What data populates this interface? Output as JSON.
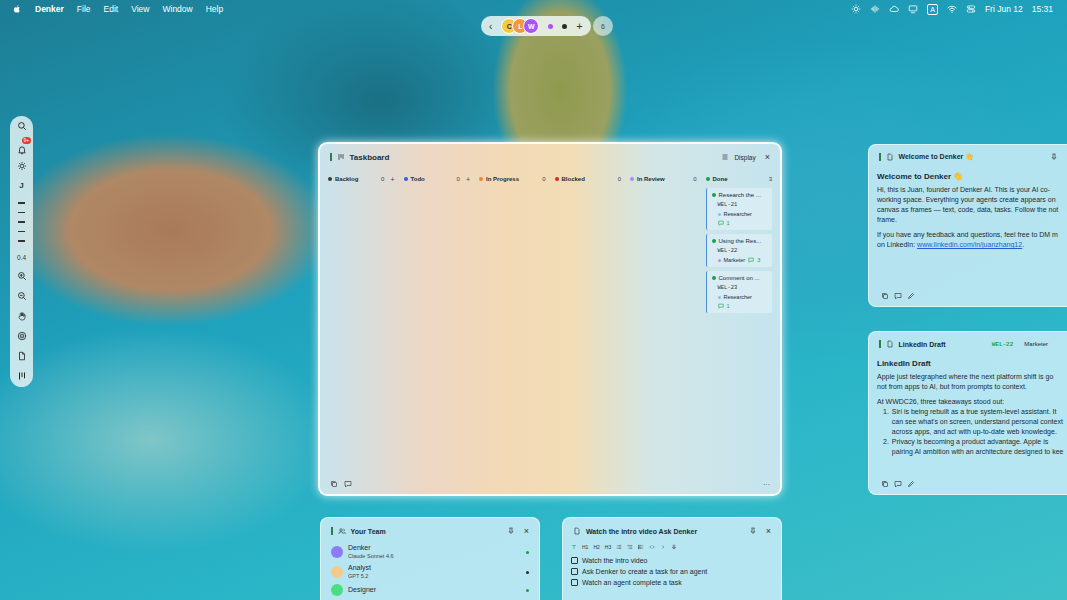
{
  "menu_bar": {
    "app": "Denker",
    "menus": [
      "File",
      "Edit",
      "View",
      "Window",
      "Help"
    ],
    "input_source": "A",
    "date": "Fri Jun 12",
    "time": "15:31"
  },
  "presence": {
    "back": "‹",
    "avatars": [
      {
        "initial": "C",
        "color": "#f6c945"
      },
      {
        "initial": "L",
        "color": "#f29b38"
      },
      {
        "initial": "W",
        "color": "#a855f7"
      }
    ],
    "dots": [
      {
        "color": "#a855f7"
      },
      {
        "color": "#2b2b2b"
      }
    ],
    "add": "+",
    "count": "6"
  },
  "toolbar": {
    "notification_badge": "9+",
    "user_initial": "J",
    "frame_marks": 5,
    "zoom": "0.4"
  },
  "taskboard": {
    "title": "Taskboard",
    "display": "Display",
    "close": "×",
    "more": "···",
    "columns": [
      {
        "name": "Backlog",
        "count": "0",
        "addable": true,
        "add": "+",
        "color": "#3a3a3a",
        "cards": []
      },
      {
        "name": "Todo",
        "count": "0",
        "addable": true,
        "add": "+",
        "color": "#2563eb",
        "cards": []
      },
      {
        "name": "In Progress",
        "count": "0",
        "addable": false,
        "add": "",
        "color": "#e8873a",
        "cards": []
      },
      {
        "name": "Blocked",
        "count": "0",
        "addable": false,
        "add": "",
        "color": "#dc2626",
        "cards": []
      },
      {
        "name": "In Review",
        "count": "0",
        "addable": false,
        "add": "",
        "color": "#a78bfa",
        "cards": []
      },
      {
        "name": "Done",
        "count": "3",
        "addable": false,
        "add": "",
        "color": "#16a34a",
        "cards": [
          {
            "title": "Research the ...",
            "id": "WEL-21",
            "role": "Researcher",
            "role_color": "#7cc4e8",
            "comments": "1"
          },
          {
            "title": "Using the Res...",
            "id": "WEL-22",
            "role": "Marketer",
            "role_color": "#b98be8",
            "comments": "3"
          },
          {
            "title": "Comment on ...",
            "id": "WEL-23",
            "role": "Researcher",
            "role_color": "#7cc4e8",
            "comments": "1"
          }
        ]
      }
    ]
  },
  "welcome": {
    "header": "Welcome to Denker 👋",
    "heading": "Welcome to Denker 👋",
    "lines": [
      "Hi, this is Juan, founder of Denker AI. This is your AI co-",
      "working space. Everything your agents create appears on",
      "canvas as frames — text, code, data, tasks. Follow the not",
      "frame."
    ],
    "feedback_line": "If you have any feedback and questions, feel free to DM m",
    "link_prefix": "on LinkedIn: ",
    "link": "www.linkedin.com/in/juanzhang12",
    "link_suffix": "."
  },
  "linkedin": {
    "header": "LinkedIn Draft",
    "task_id": "WEL-22",
    "role": "Marketer",
    "heading": "LinkedIn Draft",
    "intro_lines": [
      "Apple just telegraphed where the next platform shift is go",
      "not from apps to AI, but from prompts to context."
    ],
    "takeaways_intro": "At WWDC26, three takeaways stood out:",
    "points": [
      {
        "number": "1.",
        "lines": [
          "Siri is being rebuilt as a true system-level assistant. It",
          "can see what's on screen, understand personal context",
          "across apps, and act with up-to-date web knowledge."
        ]
      },
      {
        "number": "2.",
        "lines": [
          "Privacy is becoming a product advantage. Apple is",
          "pairing AI ambition with an architecture designed to kee"
        ]
      }
    ]
  },
  "team": {
    "title": "Your Team",
    "close": "×",
    "members": [
      {
        "name": "Denker",
        "model": "Claude Sonnet 4.6",
        "avatar_color": "#8b7cf6",
        "status_color": "#16a34a"
      },
      {
        "name": "Analyst",
        "model": "GPT 5.2",
        "avatar_color": "#f5c98a",
        "status_color": "#2b2b2b"
      },
      {
        "name": "Designer",
        "model": "",
        "avatar_color": "#4ade80",
        "status_color": "#16a34a"
      }
    ]
  },
  "checklist": {
    "title": "Watch the intro video Ask Denker",
    "close": "×",
    "formats": [
      "H1",
      "H2",
      "H3"
    ],
    "items": [
      {
        "label": "Watch the intro video",
        "checked": false
      },
      {
        "label": "Ask Denker to create a task for an agent",
        "checked": false
      },
      {
        "label": "Watch an agent complete a task",
        "checked": false
      }
    ]
  }
}
